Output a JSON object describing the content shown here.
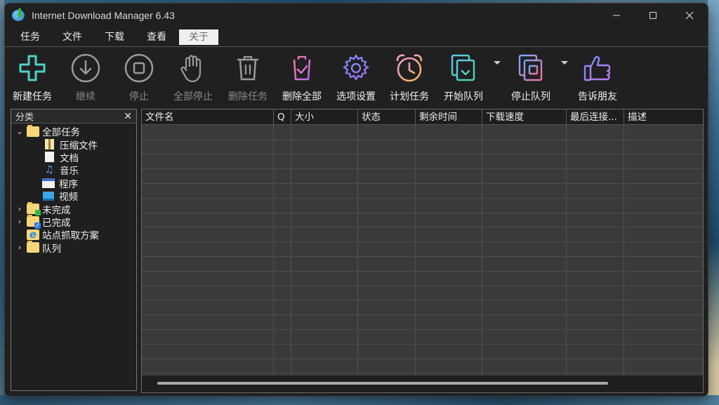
{
  "window": {
    "title": "Internet Download Manager 6.43",
    "controls": {
      "minimize": "—",
      "maximize": "☐",
      "close": "✕"
    }
  },
  "menu": [
    "任务",
    "文件",
    "下载",
    "查看",
    "关于"
  ],
  "toolbar": [
    {
      "label": "新建任务",
      "icon": "add-icon",
      "enabled": true
    },
    {
      "label": "继续",
      "icon": "resume-icon",
      "enabled": false
    },
    {
      "label": "停止",
      "icon": "stop-icon",
      "enabled": false
    },
    {
      "label": "全部停止",
      "icon": "hand-icon",
      "enabled": false
    },
    {
      "label": "删除任务",
      "icon": "trash-icon",
      "enabled": false
    },
    {
      "label": "删除全部",
      "icon": "delete-all-icon",
      "enabled": true
    },
    {
      "label": "选项设置",
      "icon": "gear-icon",
      "enabled": true
    },
    {
      "label": "计划任务",
      "icon": "alarm-clock-icon",
      "enabled": true
    },
    {
      "label": "开始队列",
      "icon": "start-queue-icon",
      "enabled": true
    },
    {
      "label": "停止队列",
      "icon": "stop-queue-icon",
      "enabled": true
    },
    {
      "label": "告诉朋友",
      "icon": "thumbs-up-icon",
      "enabled": true
    }
  ],
  "categories": {
    "header": "分类",
    "close": "✕",
    "all": "全部任务",
    "all_children": [
      "压缩文件",
      "文档",
      "音乐",
      "程序",
      "视频"
    ],
    "unfinished": "未完成",
    "finished": "已完成",
    "grabber": "站点抓取方案",
    "queues": "队列"
  },
  "table": {
    "columns": [
      "文件名",
      "Q",
      "大小",
      "状态",
      "剩余时间",
      "下载速度",
      "最后连接...",
      "描述"
    ]
  }
}
